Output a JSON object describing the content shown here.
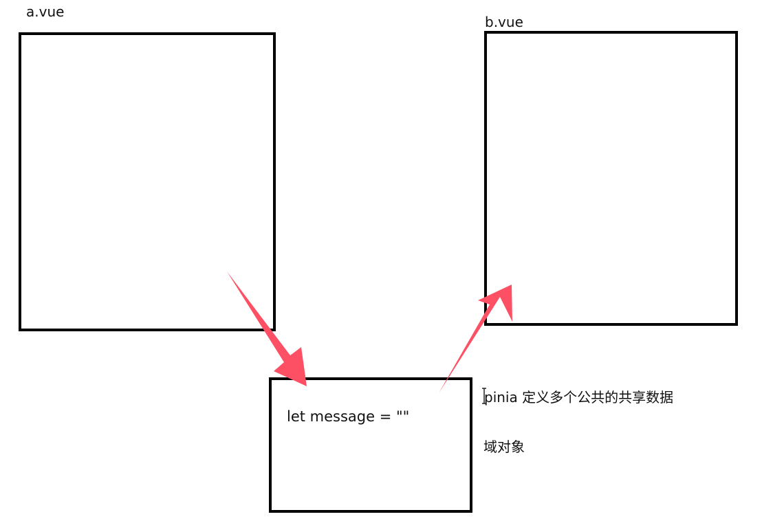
{
  "diagram": {
    "components": {
      "a": {
        "label": "a.vue"
      },
      "b": {
        "label": "b.vue"
      }
    },
    "store": {
      "code": "let message = \"\""
    },
    "notes": {
      "pinia": "pinia 定义多个公共的共享数据",
      "domain_object": "域对象"
    },
    "arrow_color": "#fd5064"
  }
}
